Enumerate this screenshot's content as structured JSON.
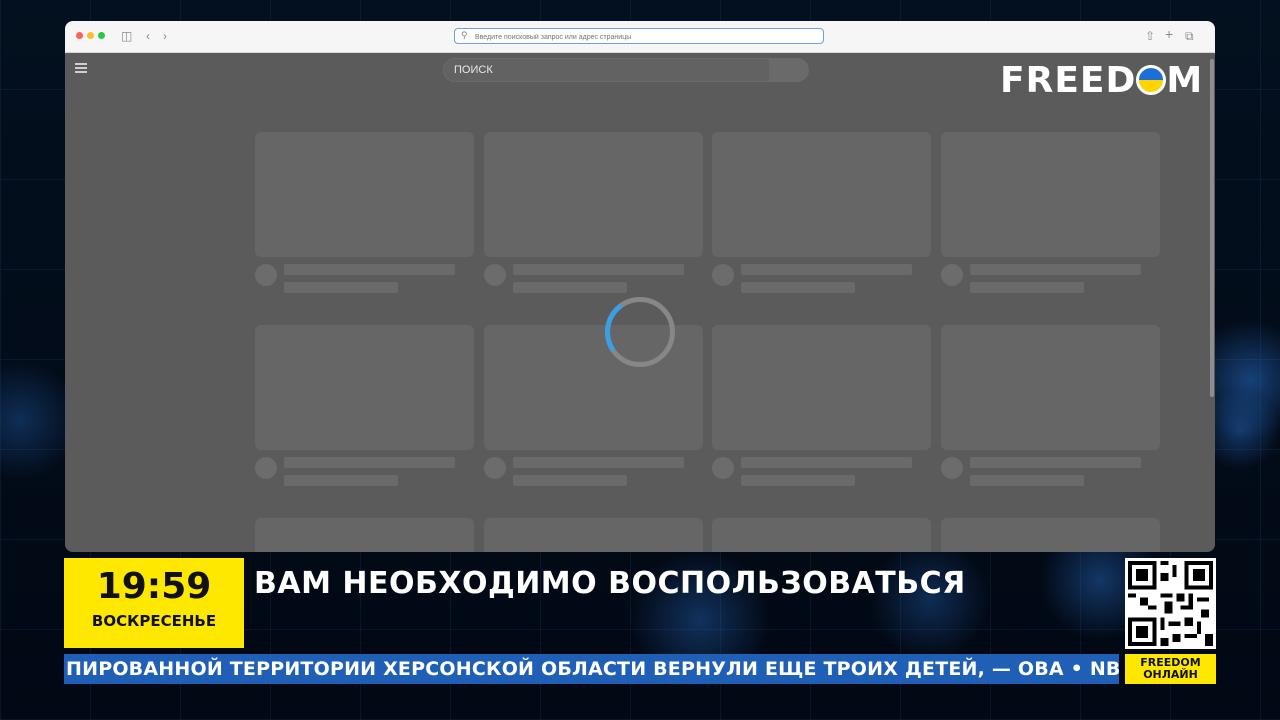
{
  "browser": {
    "address_placeholder": "Введите поисковый запрос или адрес страницы"
  },
  "site": {
    "search_label": "ПОИСК",
    "logo_text": [
      "FREED",
      "M"
    ]
  },
  "broadcast": {
    "time": "19:59",
    "day": "ВОСКРЕСЕНЬЕ",
    "headline": "ВАМ НЕОБХОДИМО ВОСПОЛЬЗОВАТЬСЯ",
    "ticker": "ПИРОВАННОЙ ТЕРРИТОРИИ ХЕРСОНСКОЙ ОБЛАСТИ ВЕРНУЛИ ЕЩЕ ТРОИХ ДЕТЕЙ, — ОВА  •  NBC: УИТКОФФ ВЕ",
    "live_line1": "FREEDOM",
    "live_line2": "ОНЛАЙН"
  },
  "colors": {
    "accent_yellow": "#ffe800",
    "ticker_blue": "#1f5fb5",
    "spinner_blue": "#3aa0e6"
  },
  "icons": {
    "sidebar": "sidebar-icon",
    "back": "chevron-left-icon",
    "forward": "chevron-right-icon",
    "share": "share-icon",
    "new_tab": "plus-icon",
    "tabs": "tabs-icon",
    "menu": "hamburger-icon",
    "loading": "spinner-icon"
  }
}
